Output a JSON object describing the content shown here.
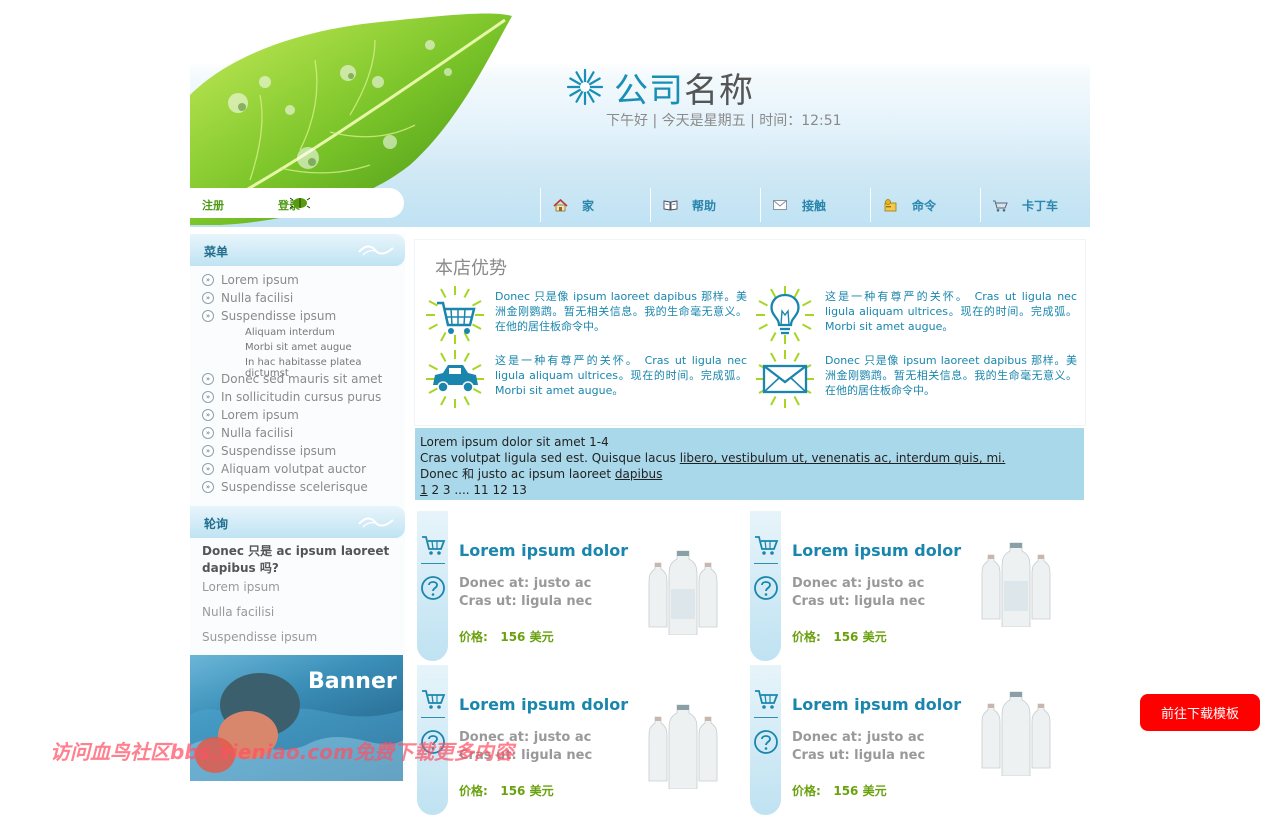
{
  "header": {
    "brand_part1": "公司",
    "brand_part2": "名称",
    "greeting": "下午好 | 今天是星期五 | 时间：12:51",
    "register": "注册",
    "login": "登录"
  },
  "nav": [
    {
      "label": "家",
      "icon": "home-icon"
    },
    {
      "label": "帮助",
      "icon": "book-icon"
    },
    {
      "label": "接触",
      "icon": "mail-icon"
    },
    {
      "label": "命令",
      "icon": "order-icon"
    },
    {
      "label": "卡丁车",
      "icon": "cart-icon"
    }
  ],
  "sidebar": {
    "menu_title": "菜单",
    "menu_items": [
      "Lorem ipsum",
      "Nulla facilisi",
      "Suspendisse ipsum",
      "Donec sed mauris sit amet",
      "In sollicitudin cursus purus",
      "Lorem ipsum",
      "Nulla facilisi",
      "Suspendisse ipsum",
      "Aliquam volutpat auctor",
      "Suspendisse scelerisque"
    ],
    "submenu_items": [
      "Aliquam interdum",
      "Morbi sit amet augue",
      "In hac habitasse platea dictumst"
    ],
    "faq_title": "轮询",
    "faq_question": "Donec 只是 ac ipsum laoreet dapibus 吗?",
    "faq_links": [
      "Lorem ipsum",
      "Nulla facilisi",
      "Suspendisse ipsum"
    ],
    "banner": "Banner"
  },
  "advantages": {
    "title": "本店优势",
    "items": [
      {
        "text": "Donec 只是像 ipsum laoreet dapibus 那样。美洲金刚鹦鹉。暂无相关信息。我的生命毫无意义。在他的居住板命令中。",
        "icon": "shopping-cart-icon"
      },
      {
        "text": "这是一种有尊严的关怀。 Cras ut ligula nec ligula aliquam ultrices。现在的时间。完成弧。 Morbi sit amet augue。",
        "icon": "lightbulb-icon"
      },
      {
        "text": "这是一种有尊严的关怀。 Cras ut ligula nec ligula aliquam ultrices。现在的时间。完成弧。 Morbi sit amet augue。",
        "icon": "car-icon"
      },
      {
        "text": "Donec 只是像 ipsum laoreet dapibus 那样。美洲金刚鹦鹉。暂无相关信息。我的生命毫无意义。在他的居住板命令中。",
        "icon": "envelope-icon"
      }
    ]
  },
  "pager": {
    "line1": "Lorem ipsum dolor sit amet 1-4",
    "line2_text": "Cras volutpat ligula sed est. Quisque lacus ",
    "line2_link": "libero, vestibulum ut, venenatis ac, interdum quis, mi.",
    "line3_text": "Donec 和 justo ac ipsum laoreet ",
    "line3_link": "dapibus",
    "page_current": "1",
    "page_rest": " 2 3 .... 11 12 13"
  },
  "products": [
    {
      "title": "Lorem ipsum dolor",
      "desc1": "Donec at: justo ac",
      "desc2": "Cras ut: ligula nec",
      "price_label": "价格:",
      "price": "156 美元"
    },
    {
      "title": "Lorem ipsum dolor",
      "desc1": "Donec at: justo ac",
      "desc2": "Cras ut: ligula nec",
      "price_label": "价格:",
      "price": "156 美元"
    },
    {
      "title": "Lorem ipsum dolor",
      "desc1": "Donec at: justo ac",
      "desc2": "Cras ut: ligula nec",
      "price_label": "价格:",
      "price": "156 美元"
    },
    {
      "title": "Lorem ipsum dolor",
      "desc1": "Donec at: justo ac",
      "desc2": "Cras ut: ligula nec",
      "price_label": "价格:",
      "price": "156 美元"
    }
  ],
  "download_button": "前往下载模板",
  "watermark": "访问血鸟社区bbs.xieniao.com免费下载更多内容",
  "colors": {
    "accent": "#1a86ad",
    "green": "#6aa10f",
    "pager_bg": "#a9d8ea",
    "download_btn": "#ff0000"
  }
}
